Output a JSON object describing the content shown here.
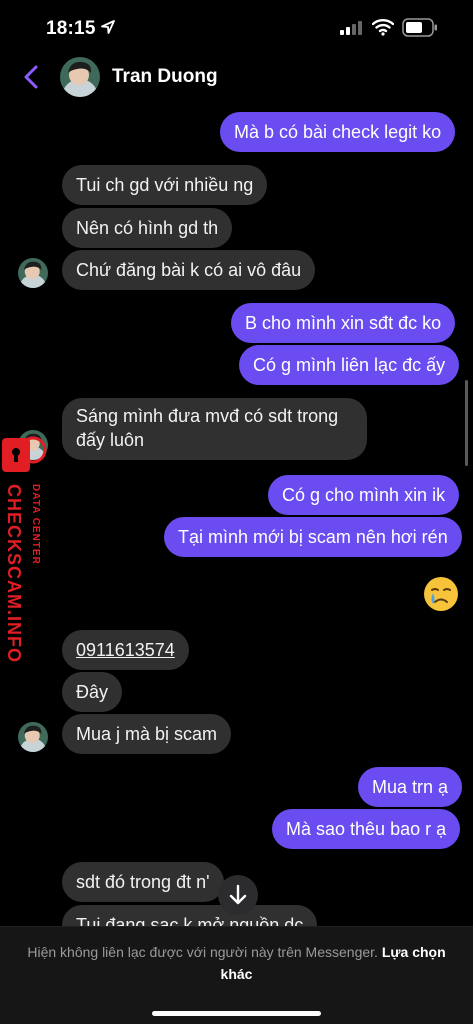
{
  "status_bar": {
    "time": "18:15"
  },
  "header": {
    "contact_name": "Tran Duong"
  },
  "messages": [
    {
      "text": "Mà b có bài check legit ko",
      "dir": "out"
    },
    {
      "text": "Tui ch gd với nhiều ng",
      "dir": "in"
    },
    {
      "text": "Nên có hình gd th",
      "dir": "in"
    },
    {
      "text": "Chứ đăng bài k có ai vô đâu",
      "dir": "in"
    },
    {
      "text": "B cho mình xin sđt đc ko",
      "dir": "out"
    },
    {
      "text": "Có g mình liên lạc đc ấy",
      "dir": "out"
    },
    {
      "text": "Sáng mình đưa mvđ có sdt trong đấy luôn",
      "dir": "in"
    },
    {
      "text": "Có g cho mình xin ik",
      "dir": "out"
    },
    {
      "text": "Tại mình mới bị scam nên hơi rén",
      "dir": "out"
    },
    {
      "text": "0911613574",
      "dir": "in"
    },
    {
      "text": "Đây",
      "dir": "in"
    },
    {
      "text": "Mua j mà bị scam",
      "dir": "in"
    },
    {
      "text": "Mua trn ạ",
      "dir": "out"
    },
    {
      "text": "Mà sao thêu bao r ạ",
      "dir": "out"
    },
    {
      "text": "sdt đó trong đt n'",
      "dir": "in"
    },
    {
      "text": "Tui đang sạc k mở nguồn dc",
      "dir": "in"
    }
  ],
  "reaction_emoji": "crying-face-emoji",
  "watermark": {
    "title": "CHECKSCAM.INFO",
    "subtitle": "DATA CENTER"
  },
  "footer": {
    "notice": "Hiện không liên lạc được với người này trên Messenger.",
    "link": "Lựa chọn khác"
  },
  "colors": {
    "outgoing_bubble": "#6a4cf0",
    "incoming_bubble": "#303030",
    "accent": "#8e5cff",
    "background": "#000000"
  }
}
